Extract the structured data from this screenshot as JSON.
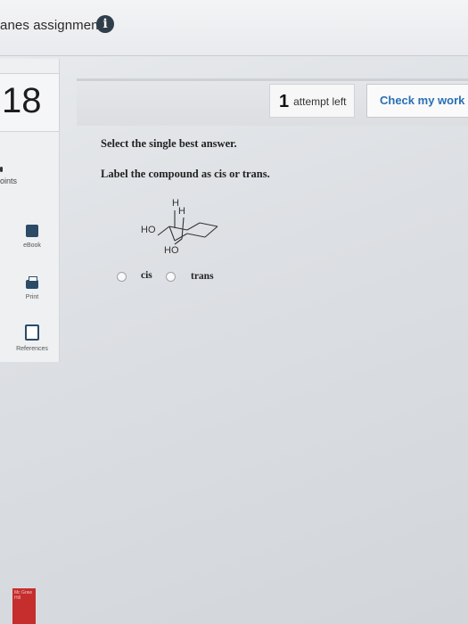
{
  "header": {
    "title": "anes assignment",
    "info_icon": "info-icon"
  },
  "sidebar": {
    "question_number": "18",
    "points_label": "oints",
    "buttons": [
      {
        "label": "eBook",
        "icon": "book-icon"
      },
      {
        "label": "Print",
        "icon": "print-icon"
      },
      {
        "label": "References",
        "icon": "references-icon"
      }
    ]
  },
  "question_bar": {
    "attempt_count": "1",
    "attempt_label": "attempt left",
    "check_button": "Check my work"
  },
  "question": {
    "instruction": "Select the single best answer.",
    "prompt": "Label the compound as cis or trans.",
    "structure_labels": {
      "h1": "H",
      "h2": "H",
      "ho1": "HO",
      "ho2": "HO"
    },
    "options": [
      {
        "label": "cis"
      },
      {
        "label": "trans"
      }
    ]
  },
  "footer": {
    "logo_text": "Mc Graw Hill"
  }
}
